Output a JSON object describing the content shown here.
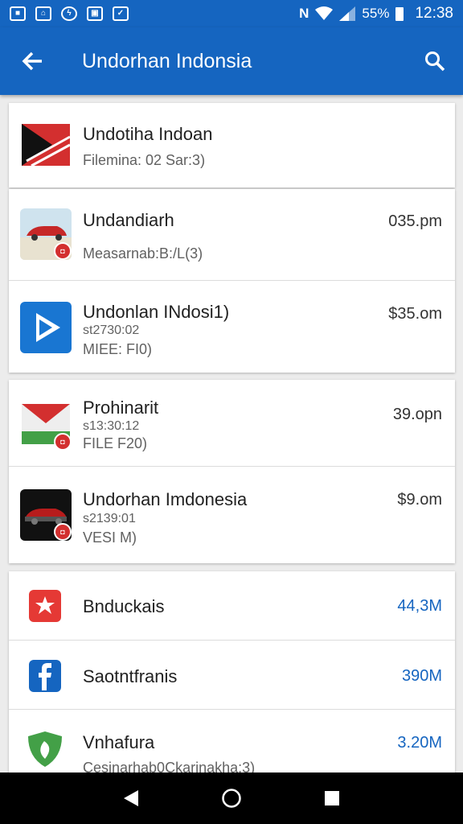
{
  "status_bar": {
    "battery": "55%",
    "time": "12:38",
    "left_icons": [
      "notification-icon",
      "home-notification-icon",
      "messenger-icon",
      "gallery-icon",
      "cast-icon"
    ]
  },
  "app_bar": {
    "title": "Undorhan Indonsia",
    "back_icon": "arrow-left-icon",
    "search_icon": "search-icon"
  },
  "group1": [
    {
      "title": "Undotiha Indoan",
      "subtitle": "Filemina: 02 Sar:3)",
      "icon": "flag-icon"
    }
  ],
  "group2": [
    {
      "title": "Undandiarh",
      "subtitle": "Measarnab:B:/L(3)",
      "value": "035.pm",
      "icon": "car-icon"
    },
    {
      "title": "Undonlan INdosi1)",
      "subtitle": "st2730:02",
      "meta": "MIEE: FI0)",
      "value": "$35.om",
      "icon": "play-icon"
    }
  ],
  "group3": [
    {
      "title": "Prohinarit",
      "subtitle": "s13:30:12",
      "meta": "FILE F20)",
      "value": "39.opn",
      "icon": "flag-green-icon"
    },
    {
      "title": "Undorhan Imdonesia",
      "subtitle": "s2139:01",
      "meta": "VESI M)",
      "value": "$9.om",
      "icon": "car-dark-icon"
    }
  ],
  "group4": [
    {
      "title": "Bnduckais",
      "value": "44,3M",
      "icon": "star-icon"
    },
    {
      "title": "Saotntfranis",
      "value": "390M",
      "icon": "facebook-icon"
    },
    {
      "title": "Vnhafura",
      "subtitle": "Cesinarhab0Ckarinakha:3)",
      "value": "3.20M",
      "icon": "shield-leaf-icon"
    }
  ],
  "nav": {
    "back": "back-triangle-icon",
    "home": "home-circle-icon",
    "recents": "recents-square-icon"
  },
  "colors": {
    "primary": "#1565c0",
    "accent_red": "#d32f2f",
    "accent_green": "#43a047"
  }
}
